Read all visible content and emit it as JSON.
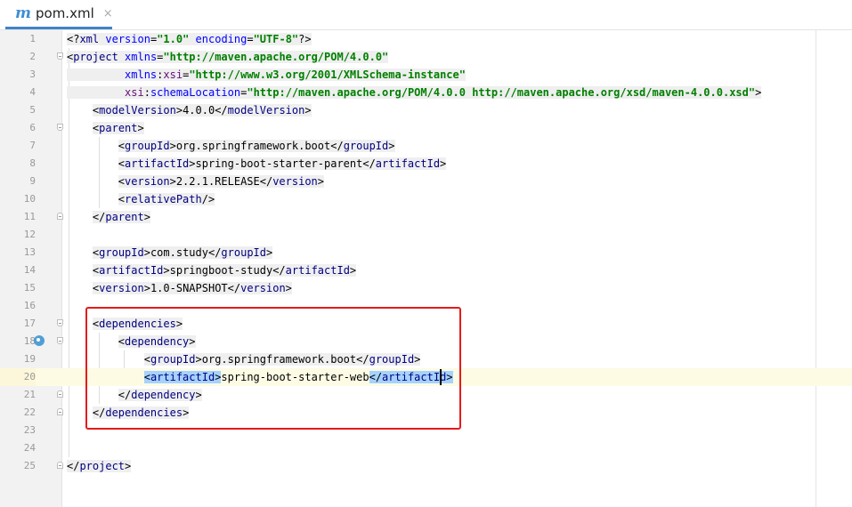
{
  "tab": {
    "icon": "maven-icon",
    "icon_glyph": "m",
    "label": "pom.xml",
    "close_glyph": "×"
  },
  "lines": [
    {
      "num": "1",
      "code": "<span class=\"bg\">&lt;?<span class=\"tag\">xml</span> <span class=\"attr\">version</span>=<span class=\"sval\">\"1.0\"</span> <span class=\"attr\">encoding</span>=<span class=\"sval\">\"UTF-8\"</span>?&gt;</span>"
    },
    {
      "num": "2",
      "code": "<span class=\"bg\">&lt;<span class=\"tag\">project</span> <span class=\"attr\">xmlns</span>=<span class=\"sval\">\"http://maven.apache.org/POM/4.0.0\"</span></span>",
      "fold": "open"
    },
    {
      "num": "3",
      "code": "<span class=\"bg\">         <span class=\"attr\">xmlns</span>:<span class=\"ns\">xsi</span>=<span class=\"sval\">\"http://www.w3.org/2001/XMLSchema-instance\"</span></span>"
    },
    {
      "num": "4",
      "code": "<span class=\"bg\">         <span class=\"ns\">xsi</span>:<span class=\"attr\">schemaLocation</span>=<span class=\"sval\">\"http://maven.apache.org/POM/4.0.0 http://maven.apache.org/xsd/maven-4.0.0.xsd\"</span>&gt;</span>"
    },
    {
      "num": "5",
      "code": "    <span class=\"bg\">&lt;<span class=\"tag\">modelVersion</span>&gt;4.0.0&lt;/<span class=\"tag\">modelVersion</span>&gt;</span>"
    },
    {
      "num": "6",
      "code": "    <span class=\"bg\">&lt;<span class=\"tag\">parent</span>&gt;</span>",
      "fold": "open"
    },
    {
      "num": "7",
      "code": "        <span class=\"bg\">&lt;<span class=\"tag\">groupId</span>&gt;org.springframework.boot&lt;/<span class=\"tag\">groupId</span>&gt;</span>"
    },
    {
      "num": "8",
      "code": "        <span class=\"bg\">&lt;<span class=\"tag\">artifactId</span>&gt;spring-boot-starter-parent&lt;/<span class=\"tag\">artifactId</span>&gt;</span>"
    },
    {
      "num": "9",
      "code": "        <span class=\"bg\">&lt;<span class=\"tag\">version</span>&gt;2.2.1.RELEASE&lt;/<span class=\"tag\">version</span>&gt;</span>"
    },
    {
      "num": "10",
      "code": "        <span class=\"bg\">&lt;<span class=\"tag\">relativePath</span>/&gt;</span>"
    },
    {
      "num": "11",
      "code": "    <span class=\"bg\">&lt;/<span class=\"tag\">parent</span>&gt;</span>",
      "fold": "close"
    },
    {
      "num": "12",
      "code": ""
    },
    {
      "num": "13",
      "code": "    <span class=\"bg\">&lt;<span class=\"tag\">groupId</span>&gt;com.study&lt;/<span class=\"tag\">groupId</span>&gt;</span>"
    },
    {
      "num": "14",
      "code": "    <span class=\"bg\">&lt;<span class=\"tag\">artifactId</span>&gt;springboot-study&lt;/<span class=\"tag\">artifactId</span>&gt;</span>"
    },
    {
      "num": "15",
      "code": "    <span class=\"bg\">&lt;<span class=\"tag\">version</span>&gt;1.0-SNAPSHOT&lt;/<span class=\"tag\">version</span>&gt;</span>"
    },
    {
      "num": "16",
      "code": ""
    },
    {
      "num": "17",
      "code": "    <span class=\"bg\">&lt;<span class=\"tag\">dependencies</span>&gt;</span>",
      "fold": "open"
    },
    {
      "num": "18",
      "code": "        <span class=\"bg\">&lt;<span class=\"tag\">dependency</span>&gt;</span>",
      "fold": "open",
      "gicon": true
    },
    {
      "num": "19",
      "code": "            <span class=\"bg\">&lt;<span class=\"tag\">groupId</span>&gt;org.springframework.boot&lt;/<span class=\"tag\">groupId</span>&gt;</span>"
    },
    {
      "num": "20",
      "code": "            <span class=\"sel\">&lt;<span class=\"tag\">artifactId</span>&gt;</span>spring-boot-starter-web<span class=\"sel\">&lt;/<span class=\"tag\">artifactId</span>&gt;</span>",
      "hl": true
    },
    {
      "num": "21",
      "code": "        <span class=\"bg\">&lt;/<span class=\"tag\">dependency</span>&gt;</span>",
      "fold": "close"
    },
    {
      "num": "22",
      "code": "    <span class=\"bg\">&lt;/<span class=\"tag\">dependencies</span>&gt;</span>",
      "fold": "close"
    },
    {
      "num": "23",
      "code": ""
    },
    {
      "num": "24",
      "code": ""
    },
    {
      "num": "25",
      "code": "<span class=\"bg\">&lt;/<span class=\"tag\">project</span>&gt;</span>",
      "fold": "close"
    }
  ],
  "colors": {
    "tag": "#000080",
    "attr": "#0000ff",
    "value": "#008000",
    "namespace": "#660e7a",
    "selection": "#a6d2ff",
    "annotation_box": "#e41b1b",
    "tab_underline": "#4083c9"
  }
}
